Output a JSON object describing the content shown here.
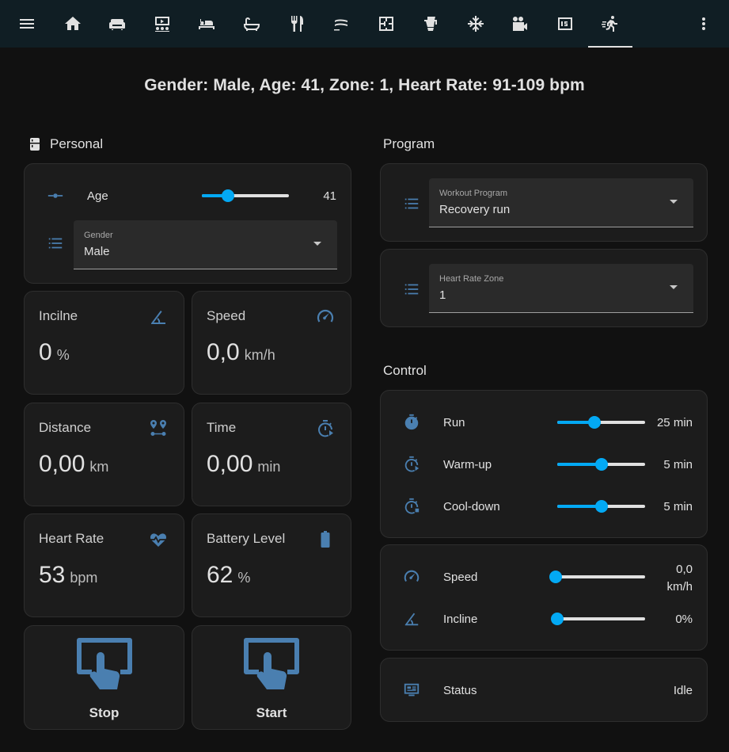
{
  "colors": {
    "topbar": "#101e24",
    "icon": "#4a7fb0",
    "accent": "#03a9f4",
    "card": "#1c1c1c",
    "background": "#111111"
  },
  "topbar": {
    "icons": [
      "menu-icon",
      "home-icon",
      "sofa-icon",
      "theater-icon",
      "bed-icon",
      "bathtub-icon",
      "dining-icon",
      "heater-icon",
      "floorplan-icon",
      "kettle-icon",
      "hvac-icon",
      "camera-icon",
      "counter-icon",
      "runner-icon",
      "more-icon"
    ],
    "active": "runner-icon"
  },
  "headline": "Gender: Male, Age: 41, Zone: 1, Heart Rate: 91-109 bpm",
  "personal": {
    "title": "Personal",
    "age": {
      "label": "Age",
      "value": "41",
      "fraction": 0.3
    },
    "gender": {
      "label": "Gender",
      "value": "Male"
    }
  },
  "tiles": [
    {
      "name": "Incilne",
      "value": "0",
      "unit": "%",
      "icon": "angle-icon"
    },
    {
      "name": "Speed",
      "value": "0,0",
      "unit": "km/h",
      "icon": "speedometer-icon"
    },
    {
      "name": "Distance",
      "value": "0,00",
      "unit": "km",
      "icon": "map-marker-distance-icon"
    },
    {
      "name": "Time",
      "value": "0,00",
      "unit": "min",
      "icon": "timer-play-icon"
    },
    {
      "name": "Heart Rate",
      "value": "53",
      "unit": "bpm",
      "icon": "heart-pulse-icon"
    },
    {
      "name": "Battery Level",
      "value": "62",
      "unit": "%",
      "icon": "battery-icon"
    }
  ],
  "buttons": {
    "stop": "Stop",
    "start": "Start"
  },
  "program": {
    "title": "Program",
    "workout": {
      "label": "Workout Program",
      "value": "Recovery run"
    },
    "zone": {
      "label": "Heart Rate Zone",
      "value": "1"
    }
  },
  "control": {
    "title": "Control",
    "run": {
      "label": "Run",
      "value": "25 min",
      "fraction": 0.42
    },
    "warmup": {
      "label": "Warm-up",
      "value": "5 min",
      "fraction": 0.5
    },
    "cooldown": {
      "label": "Cool-down",
      "value": "5 min",
      "fraction": 0.5
    },
    "speed": {
      "label": "Speed",
      "value_line1": "0,0",
      "value_line2": "km/h",
      "fraction": 0
    },
    "incline": {
      "label": "Incline",
      "value": "0%",
      "fraction": 0.02
    },
    "status": {
      "label": "Status",
      "value": "Idle"
    }
  }
}
